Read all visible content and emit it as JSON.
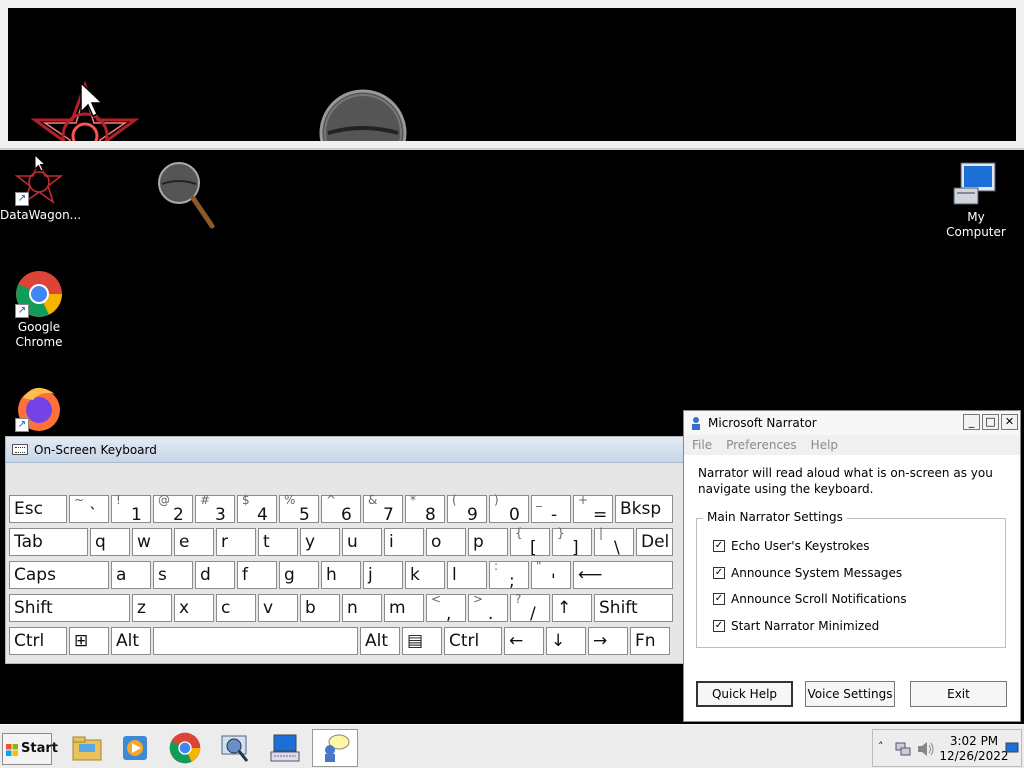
{
  "desktop": {
    "icons": [
      {
        "label": "DataWagon..."
      },
      {
        "label": "Google Chrome"
      },
      {
        "label": "My Computer"
      }
    ]
  },
  "osk": {
    "title": "On-Screen Keyboard",
    "rows": [
      [
        {
          "n": "Esc",
          "w": 58
        },
        {
          "u": "~",
          "d": "`",
          "w": 40
        },
        {
          "u": "!",
          "d": "1",
          "w": 40
        },
        {
          "u": "@",
          "d": "2",
          "w": 40
        },
        {
          "u": "#",
          "d": "3",
          "w": 40
        },
        {
          "u": "$",
          "d": "4",
          "w": 40
        },
        {
          "u": "%",
          "d": "5",
          "w": 40
        },
        {
          "u": "^",
          "d": "6",
          "w": 40
        },
        {
          "u": "&",
          "d": "7",
          "w": 40
        },
        {
          "u": "*",
          "d": "8",
          "w": 40
        },
        {
          "u": "(",
          "d": "9",
          "w": 40
        },
        {
          "u": ")",
          "d": "0",
          "w": 40
        },
        {
          "u": "_",
          "d": "-",
          "w": 40
        },
        {
          "u": "+",
          "d": "=",
          "w": 40
        },
        {
          "n": "Bksp",
          "w": 58
        }
      ],
      [
        {
          "n": "Tab",
          "w": 79
        },
        {
          "n": "q",
          "w": 40
        },
        {
          "n": "w",
          "w": 40
        },
        {
          "n": "e",
          "w": 40
        },
        {
          "n": "r",
          "w": 40
        },
        {
          "n": "t",
          "w": 40
        },
        {
          "n": "y",
          "w": 40
        },
        {
          "n": "u",
          "w": 40
        },
        {
          "n": "i",
          "w": 40
        },
        {
          "n": "o",
          "w": 40
        },
        {
          "n": "p",
          "w": 40
        },
        {
          "u": "{",
          "d": "[",
          "w": 40
        },
        {
          "u": "}",
          "d": "]",
          "w": 40
        },
        {
          "u": "|",
          "d": "\\",
          "w": 40
        },
        {
          "n": "Del",
          "w": 37
        }
      ],
      [
        {
          "n": "Caps",
          "w": 100
        },
        {
          "n": "a",
          "w": 40
        },
        {
          "n": "s",
          "w": 40
        },
        {
          "n": "d",
          "w": 40
        },
        {
          "n": "f",
          "w": 40
        },
        {
          "n": "g",
          "w": 40
        },
        {
          "n": "h",
          "w": 40
        },
        {
          "n": "j",
          "w": 40
        },
        {
          "n": "k",
          "w": 40
        },
        {
          "n": "l",
          "w": 40
        },
        {
          "u": ":",
          "d": ";",
          "w": 40
        },
        {
          "u": "\"",
          "d": "'",
          "w": 40
        },
        {
          "n": "⟵",
          "w": 100
        }
      ],
      [
        {
          "n": "Shift",
          "w": 121
        },
        {
          "n": "z",
          "w": 40
        },
        {
          "n": "x",
          "w": 40
        },
        {
          "n": "c",
          "w": 40
        },
        {
          "n": "v",
          "w": 40
        },
        {
          "n": "b",
          "w": 40
        },
        {
          "n": "n",
          "w": 40
        },
        {
          "n": "m",
          "w": 40
        },
        {
          "u": "<",
          "d": ",",
          "w": 40
        },
        {
          "u": ">",
          "d": ".",
          "w": 40
        },
        {
          "u": "?",
          "d": "/",
          "w": 40
        },
        {
          "n": "↑",
          "w": 40
        },
        {
          "n": "Shift",
          "w": 79
        }
      ],
      [
        {
          "n": "Ctrl",
          "w": 58
        },
        {
          "n": "⊞",
          "w": 40
        },
        {
          "n": "Alt",
          "w": 40
        },
        {
          "n": "",
          "w": 205
        },
        {
          "n": "Alt",
          "w": 40
        },
        {
          "n": "▤",
          "w": 40
        },
        {
          "n": "Ctrl",
          "w": 58
        },
        {
          "n": "←",
          "w": 40
        },
        {
          "n": "↓",
          "w": 40
        },
        {
          "n": "→",
          "w": 40
        },
        {
          "n": "Fn",
          "w": 40
        }
      ]
    ]
  },
  "narrator": {
    "title": "Microsoft Narrator",
    "menu": [
      "File",
      "Preferences",
      "Help"
    ],
    "description": "Narrator will read aloud what is on-screen as you navigate using the keyboard.",
    "group_title": "Main Narrator Settings",
    "options": [
      {
        "label": "Echo User's Keystrokes",
        "checked": true
      },
      {
        "label": "Announce System Messages",
        "checked": true
      },
      {
        "label": "Announce Scroll Notifications",
        "checked": true
      },
      {
        "label": "Start Narrator Minimized",
        "checked": true
      }
    ],
    "buttons": {
      "quick_help": "Quick Help",
      "voice_settings": "Voice Settings",
      "exit": "Exit"
    }
  },
  "taskbar": {
    "start_label": "Start",
    "clock": {
      "time": "3:02 PM",
      "date": "12/26/2022"
    }
  },
  "colors": {
    "desktop": "#000000",
    "window": "#ffffff",
    "chrome_red": "#db4437",
    "chrome_green": "#0f9d58",
    "chrome_yellow": "#f4b400",
    "chrome_blue": "#4285f4"
  }
}
